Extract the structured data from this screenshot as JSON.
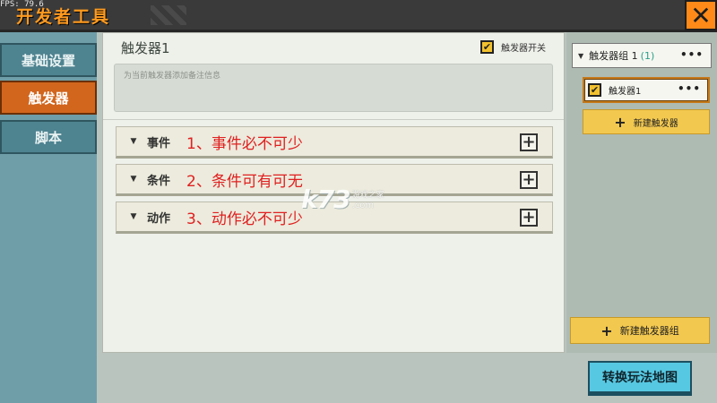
{
  "fps": "FPS: 79.6",
  "app_title": "开发者工具",
  "sidebar": {
    "items": [
      {
        "label": "基础设置",
        "active": false
      },
      {
        "label": "触发器",
        "active": true
      },
      {
        "label": "脚本",
        "active": false
      }
    ]
  },
  "main": {
    "title": "触发器1",
    "switch_label": "触发器开关",
    "switch_checked": true,
    "note_placeholder": "为当前触发器添加备注信息",
    "sections": [
      {
        "label": "事件",
        "note": "1、事件必不可少"
      },
      {
        "label": "条件",
        "note": "2、条件可有可无"
      },
      {
        "label": "动作",
        "note": "3、动作必不可少"
      }
    ]
  },
  "right_panel": {
    "group_name": "触发器组 1",
    "group_count": "(1)",
    "trigger_name": "触发器1",
    "trigger_checked": true,
    "new_trigger_label": "新建触发器",
    "new_group_label": "新建触发器组"
  },
  "switch_map_label": "转换玩法地图",
  "watermark": {
    "logo": "k73",
    "text": "游戏之家",
    "domain": ".com"
  },
  "colors": {
    "accent": "#ff9a1f",
    "sidebar": "#6f9ea8",
    "active_tab": "#d2661d",
    "button_yellow": "#f2c84f",
    "note_red": "#e02020",
    "map_button": "#57c8e2"
  }
}
